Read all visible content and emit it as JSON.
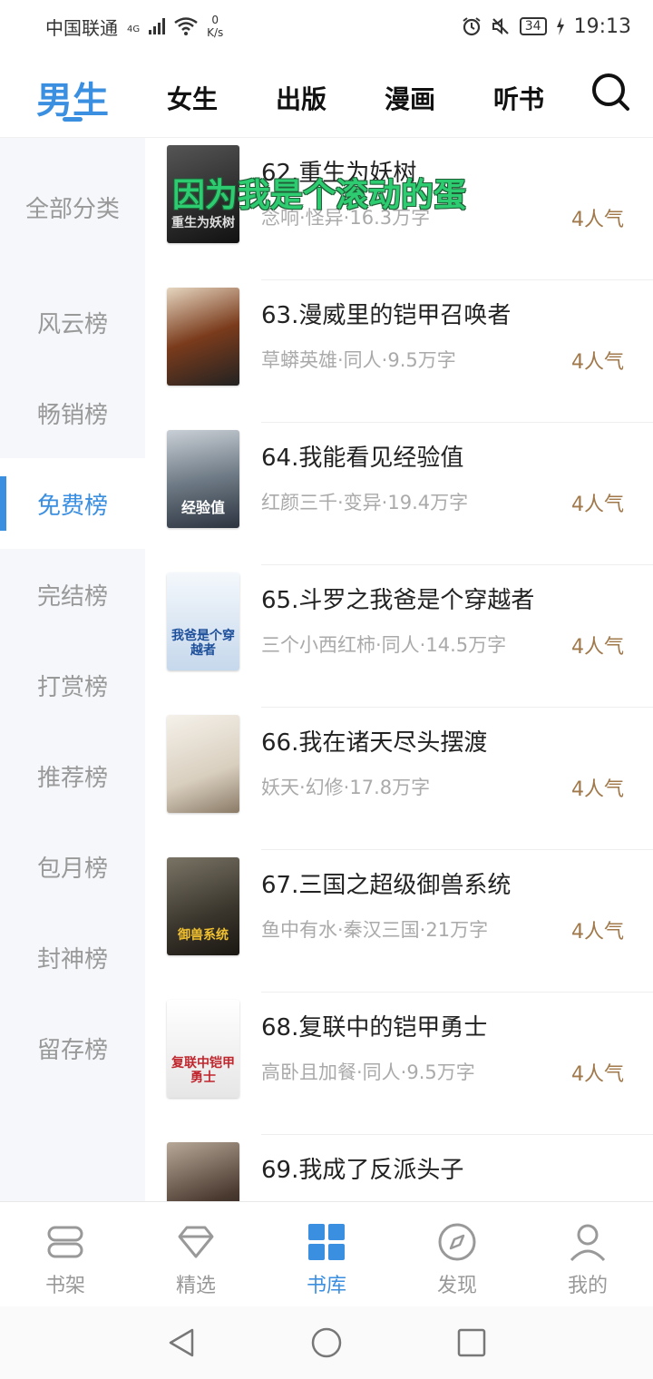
{
  "status_bar": {
    "carrier": "中国联通",
    "network": "4G",
    "speed_value": "0",
    "speed_unit": "K/s",
    "battery": "34",
    "time": "19:13"
  },
  "top_tabs": [
    "男生",
    "女生",
    "出版",
    "漫画",
    "听书"
  ],
  "active_top_tab": "男生",
  "sidebar": {
    "items": [
      "全部分类",
      "风云榜",
      "畅销榜",
      "免费榜",
      "完结榜",
      "打赏榜",
      "推荐榜",
      "包月榜",
      "封神榜",
      "留存榜"
    ],
    "active": "免费榜"
  },
  "overlay_caption": "因为我是个滚动的蛋",
  "books": [
    {
      "title": "62.重生为妖树",
      "meta": "念响·怪异·16.3万字",
      "popularity": "4人气",
      "cover_text": "重生为妖树",
      "cover_color": "#2b2b2b"
    },
    {
      "title": "63.漫威里的铠甲召唤者",
      "meta": "草蟒英雄·同人·9.5万字",
      "popularity": "4人气",
      "cover_text": "",
      "cover_color": "#6b3a22"
    },
    {
      "title": "64.我能看见经验值",
      "meta": "红颜三千·变异·19.4万字",
      "popularity": "4人气",
      "cover_text": "经验值",
      "cover_color": "#5a6a7a"
    },
    {
      "title": "65.斗罗之我爸是个穿越者",
      "meta": "三个小西红柿·同人·14.5万字",
      "popularity": "4人气",
      "cover_text": "我爸是个穿越者",
      "cover_color": "#dbe7f3"
    },
    {
      "title": "66.我在诸天尽头摆渡",
      "meta": "妖天·幻修·17.8万字",
      "popularity": "4人气",
      "cover_text": "",
      "cover_color": "#e9e3d8"
    },
    {
      "title": "67.三国之超级御兽系统",
      "meta": "鱼中有水·秦汉三国·21万字",
      "popularity": "4人气",
      "cover_text": "御兽系统",
      "cover_color": "#3d3a33"
    },
    {
      "title": "68.复联中的铠甲勇士",
      "meta": "高卧且加餐·同人·9.5万字",
      "popularity": "4人气",
      "cover_text": "复联中铠甲勇士",
      "cover_color": "#f2f2f2"
    },
    {
      "title": "69.我成了反派头子",
      "meta": "",
      "popularity": "",
      "cover_text": "",
      "cover_color": "#4a3a30"
    }
  ],
  "bottom_nav": {
    "items": [
      {
        "label": "书架",
        "icon": "bookshelf-icon"
      },
      {
        "label": "精选",
        "icon": "diamond-icon"
      },
      {
        "label": "书库",
        "icon": "grid-icon"
      },
      {
        "label": "发现",
        "icon": "compass-icon"
      },
      {
        "label": "我的",
        "icon": "person-icon"
      }
    ],
    "active": "书库"
  },
  "colors": {
    "accent": "#3b8fe0",
    "popularity": "#a0784a",
    "overlay": "#2ecc71"
  }
}
